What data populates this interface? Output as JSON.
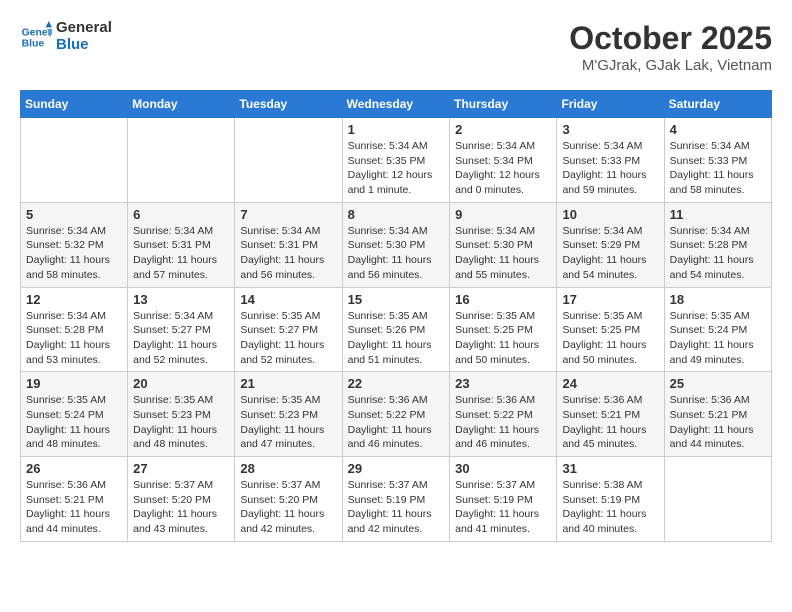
{
  "logo": {
    "line1": "General",
    "line2": "Blue"
  },
  "title": "October 2025",
  "location": "M'GJrak, GJak Lak, Vietnam",
  "days_of_week": [
    "Sunday",
    "Monday",
    "Tuesday",
    "Wednesday",
    "Thursday",
    "Friday",
    "Saturday"
  ],
  "weeks": [
    [
      {
        "day": "",
        "info": ""
      },
      {
        "day": "",
        "info": ""
      },
      {
        "day": "",
        "info": ""
      },
      {
        "day": "1",
        "info": "Sunrise: 5:34 AM\nSunset: 5:35 PM\nDaylight: 12 hours\nand 1 minute."
      },
      {
        "day": "2",
        "info": "Sunrise: 5:34 AM\nSunset: 5:34 PM\nDaylight: 12 hours\nand 0 minutes."
      },
      {
        "day": "3",
        "info": "Sunrise: 5:34 AM\nSunset: 5:33 PM\nDaylight: 11 hours\nand 59 minutes."
      },
      {
        "day": "4",
        "info": "Sunrise: 5:34 AM\nSunset: 5:33 PM\nDaylight: 11 hours\nand 58 minutes."
      }
    ],
    [
      {
        "day": "5",
        "info": "Sunrise: 5:34 AM\nSunset: 5:32 PM\nDaylight: 11 hours\nand 58 minutes."
      },
      {
        "day": "6",
        "info": "Sunrise: 5:34 AM\nSunset: 5:31 PM\nDaylight: 11 hours\nand 57 minutes."
      },
      {
        "day": "7",
        "info": "Sunrise: 5:34 AM\nSunset: 5:31 PM\nDaylight: 11 hours\nand 56 minutes."
      },
      {
        "day": "8",
        "info": "Sunrise: 5:34 AM\nSunset: 5:30 PM\nDaylight: 11 hours\nand 56 minutes."
      },
      {
        "day": "9",
        "info": "Sunrise: 5:34 AM\nSunset: 5:30 PM\nDaylight: 11 hours\nand 55 minutes."
      },
      {
        "day": "10",
        "info": "Sunrise: 5:34 AM\nSunset: 5:29 PM\nDaylight: 11 hours\nand 54 minutes."
      },
      {
        "day": "11",
        "info": "Sunrise: 5:34 AM\nSunset: 5:28 PM\nDaylight: 11 hours\nand 54 minutes."
      }
    ],
    [
      {
        "day": "12",
        "info": "Sunrise: 5:34 AM\nSunset: 5:28 PM\nDaylight: 11 hours\nand 53 minutes."
      },
      {
        "day": "13",
        "info": "Sunrise: 5:34 AM\nSunset: 5:27 PM\nDaylight: 11 hours\nand 52 minutes."
      },
      {
        "day": "14",
        "info": "Sunrise: 5:35 AM\nSunset: 5:27 PM\nDaylight: 11 hours\nand 52 minutes."
      },
      {
        "day": "15",
        "info": "Sunrise: 5:35 AM\nSunset: 5:26 PM\nDaylight: 11 hours\nand 51 minutes."
      },
      {
        "day": "16",
        "info": "Sunrise: 5:35 AM\nSunset: 5:25 PM\nDaylight: 11 hours\nand 50 minutes."
      },
      {
        "day": "17",
        "info": "Sunrise: 5:35 AM\nSunset: 5:25 PM\nDaylight: 11 hours\nand 50 minutes."
      },
      {
        "day": "18",
        "info": "Sunrise: 5:35 AM\nSunset: 5:24 PM\nDaylight: 11 hours\nand 49 minutes."
      }
    ],
    [
      {
        "day": "19",
        "info": "Sunrise: 5:35 AM\nSunset: 5:24 PM\nDaylight: 11 hours\nand 48 minutes."
      },
      {
        "day": "20",
        "info": "Sunrise: 5:35 AM\nSunset: 5:23 PM\nDaylight: 11 hours\nand 48 minutes."
      },
      {
        "day": "21",
        "info": "Sunrise: 5:35 AM\nSunset: 5:23 PM\nDaylight: 11 hours\nand 47 minutes."
      },
      {
        "day": "22",
        "info": "Sunrise: 5:36 AM\nSunset: 5:22 PM\nDaylight: 11 hours\nand 46 minutes."
      },
      {
        "day": "23",
        "info": "Sunrise: 5:36 AM\nSunset: 5:22 PM\nDaylight: 11 hours\nand 46 minutes."
      },
      {
        "day": "24",
        "info": "Sunrise: 5:36 AM\nSunset: 5:21 PM\nDaylight: 11 hours\nand 45 minutes."
      },
      {
        "day": "25",
        "info": "Sunrise: 5:36 AM\nSunset: 5:21 PM\nDaylight: 11 hours\nand 44 minutes."
      }
    ],
    [
      {
        "day": "26",
        "info": "Sunrise: 5:36 AM\nSunset: 5:21 PM\nDaylight: 11 hours\nand 44 minutes."
      },
      {
        "day": "27",
        "info": "Sunrise: 5:37 AM\nSunset: 5:20 PM\nDaylight: 11 hours\nand 43 minutes."
      },
      {
        "day": "28",
        "info": "Sunrise: 5:37 AM\nSunset: 5:20 PM\nDaylight: 11 hours\nand 42 minutes."
      },
      {
        "day": "29",
        "info": "Sunrise: 5:37 AM\nSunset: 5:19 PM\nDaylight: 11 hours\nand 42 minutes."
      },
      {
        "day": "30",
        "info": "Sunrise: 5:37 AM\nSunset: 5:19 PM\nDaylight: 11 hours\nand 41 minutes."
      },
      {
        "day": "31",
        "info": "Sunrise: 5:38 AM\nSunset: 5:19 PM\nDaylight: 11 hours\nand 40 minutes."
      },
      {
        "day": "",
        "info": ""
      }
    ]
  ]
}
